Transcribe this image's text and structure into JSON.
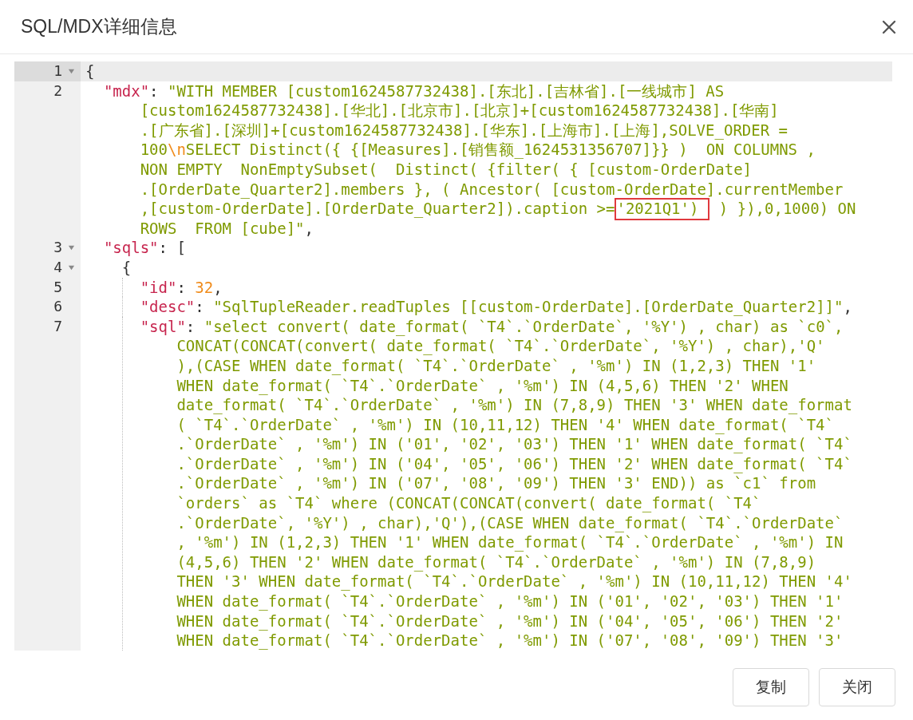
{
  "dialog": {
    "title": "SQL/MDX详细信息"
  },
  "editor": {
    "lines": [
      {
        "number": "1",
        "expanded": true,
        "selected": true,
        "rows": [
          {
            "tokens": [
              {
                "kind": "punct",
                "text": "{"
              }
            ]
          }
        ]
      },
      {
        "number": "2",
        "selected": false,
        "rows": [
          {
            "tokens": [
              {
                "kind": "key",
                "text": "  \"mdx\""
              },
              {
                "kind": "punct",
                "text": ": "
              },
              {
                "kind": "string",
                "text": "\"WITH MEMBER [custom1624587732438].[东北].[吉林省].[一线城市] AS"
              }
            ]
          },
          {
            "tokens": [
              {
                "kind": "string",
                "text": "[custom1624587732438].[华北].[北京市].[北京]+[custom1624587732438].[华南]"
              }
            ]
          },
          {
            "tokens": [
              {
                "kind": "string",
                "text": ".[广东省].[深圳]+[custom1624587732438].[华东].[上海市].[上海],SOLVE_ORDER ="
              }
            ]
          },
          {
            "tokens": [
              {
                "kind": "string",
                "text": "100"
              },
              {
                "kind": "escape",
                "text": "\\n"
              },
              {
                "kind": "string",
                "text": "SELECT Distinct({ {[Measures].[销售额_1624531356707]}} )  ON COLUMNS ,"
              }
            ]
          },
          {
            "tokens": [
              {
                "kind": "string",
                "text": "NON EMPTY  NonEmptySubset(  Distinct( {filter( { [custom-OrderDate]"
              }
            ]
          },
          {
            "tokens": [
              {
                "kind": "string",
                "text": ".[OrderDate_Quarter2].members }, ( Ancestor( [custom-OrderDate].currentMember"
              }
            ]
          },
          {
            "tokens": [
              {
                "kind": "string",
                "text": ",[custom-OrderDate].[OrderDate_Quarter2]).caption >="
              },
              {
                "kind": "highlight",
                "text": "'2021Q1')"
              },
              {
                "kind": "string",
                "text": " ) }),0,1000) ON"
              }
            ]
          },
          {
            "tokens": [
              {
                "kind": "string",
                "text": "ROWS  FROM [cube]\""
              },
              {
                "kind": "punct",
                "text": ","
              }
            ]
          }
        ]
      },
      {
        "number": "3",
        "expanded": true,
        "selected": false,
        "rows": [
          {
            "tokens": [
              {
                "kind": "key",
                "text": "  \"sqls\""
              },
              {
                "kind": "punct",
                "text": ": ["
              }
            ]
          }
        ]
      },
      {
        "number": "4",
        "expanded": true,
        "selected": false,
        "rows": [
          {
            "tokens": [
              {
                "kind": "punct",
                "text": "    {"
              }
            ]
          }
        ]
      },
      {
        "number": "5",
        "selected": false,
        "rows": [
          {
            "tokens": [
              {
                "kind": "key",
                "text": "      \"id\""
              },
              {
                "kind": "punct",
                "text": ": "
              },
              {
                "kind": "number",
                "text": "32"
              },
              {
                "kind": "punct",
                "text": ","
              }
            ]
          }
        ]
      },
      {
        "number": "6",
        "selected": false,
        "rows": [
          {
            "tokens": [
              {
                "kind": "key",
                "text": "      \"desc\""
              },
              {
                "kind": "punct",
                "text": ": "
              },
              {
                "kind": "string",
                "text": "\"SqlTupleReader.readTuples [[custom-OrderDate].[OrderDate_Quarter2]]\""
              },
              {
                "kind": "punct",
                "text": ","
              }
            ]
          }
        ]
      },
      {
        "number": "7",
        "selected": false,
        "rows": [
          {
            "tokens": [
              {
                "kind": "key",
                "text": "      \"sql\""
              },
              {
                "kind": "punct",
                "text": ": "
              },
              {
                "kind": "string",
                "text": "\"select convert( date_format( `T4`.`OrderDate`, '%Y') , char) as `c0`,"
              }
            ]
          },
          {
            "tokens": [
              {
                "kind": "string",
                "text": "CONCAT(CONCAT(convert( date_format( `T4`.`OrderDate`, '%Y') , char),'Q'"
              }
            ]
          },
          {
            "tokens": [
              {
                "kind": "string",
                "text": "),(CASE WHEN date_format( `T4`.`OrderDate` , '%m') IN (1,2,3) THEN '1'"
              }
            ]
          },
          {
            "tokens": [
              {
                "kind": "string",
                "text": "WHEN date_format( `T4`.`OrderDate` , '%m') IN (4,5,6) THEN '2' WHEN"
              }
            ]
          },
          {
            "tokens": [
              {
                "kind": "string",
                "text": "date_format( `T4`.`OrderDate` , '%m') IN (7,8,9) THEN '3' WHEN date_format"
              }
            ]
          },
          {
            "tokens": [
              {
                "kind": "string",
                "text": "( `T4`.`OrderDate` , '%m') IN (10,11,12) THEN '4' WHEN date_format( `T4`"
              }
            ]
          },
          {
            "tokens": [
              {
                "kind": "string",
                "text": ".`OrderDate` , '%m') IN ('01', '02', '03') THEN '1' WHEN date_format( `T4`"
              }
            ]
          },
          {
            "tokens": [
              {
                "kind": "string",
                "text": ".`OrderDate` , '%m') IN ('04', '05', '06') THEN '2' WHEN date_format( `T4`"
              }
            ]
          },
          {
            "tokens": [
              {
                "kind": "string",
                "text": ".`OrderDate` , '%m') IN ('07', '08', '09') THEN '3' END)) as `c1` from"
              }
            ]
          },
          {
            "tokens": [
              {
                "kind": "string",
                "text": "`orders` as `T4` where (CONCAT(CONCAT(convert( date_format( `T4`"
              }
            ]
          },
          {
            "tokens": [
              {
                "kind": "string",
                "text": ".`OrderDate`, '%Y') , char),'Q'),(CASE WHEN date_format( `T4`.`OrderDate`"
              }
            ]
          },
          {
            "tokens": [
              {
                "kind": "string",
                "text": ", '%m') IN (1,2,3) THEN '1' WHEN date_format( `T4`.`OrderDate` , '%m') IN"
              }
            ]
          },
          {
            "tokens": [
              {
                "kind": "string",
                "text": "(4,5,6) THEN '2' WHEN date_format( `T4`.`OrderDate` , '%m') IN (7,8,9)"
              }
            ]
          },
          {
            "tokens": [
              {
                "kind": "string",
                "text": "THEN '3' WHEN date_format( `T4`.`OrderDate` , '%m') IN (10,11,12) THEN '4'"
              }
            ]
          },
          {
            "tokens": [
              {
                "kind": "string",
                "text": "WHEN date_format( `T4`.`OrderDate` , '%m') IN ('01', '02', '03') THEN '1'"
              }
            ]
          },
          {
            "tokens": [
              {
                "kind": "string",
                "text": "WHEN date_format( `T4`.`OrderDate` , '%m') IN ('04', '05', '06') THEN '2'"
              }
            ]
          },
          {
            "tokens": [
              {
                "kind": "string",
                "text": "WHEN date_format( `T4`.`OrderDate` , '%m') IN ('07', '08', '09') THEN '3'"
              }
            ]
          }
        ]
      }
    ]
  },
  "buttons": [
    {
      "label": "复制"
    },
    {
      "label": "关闭"
    }
  ]
}
